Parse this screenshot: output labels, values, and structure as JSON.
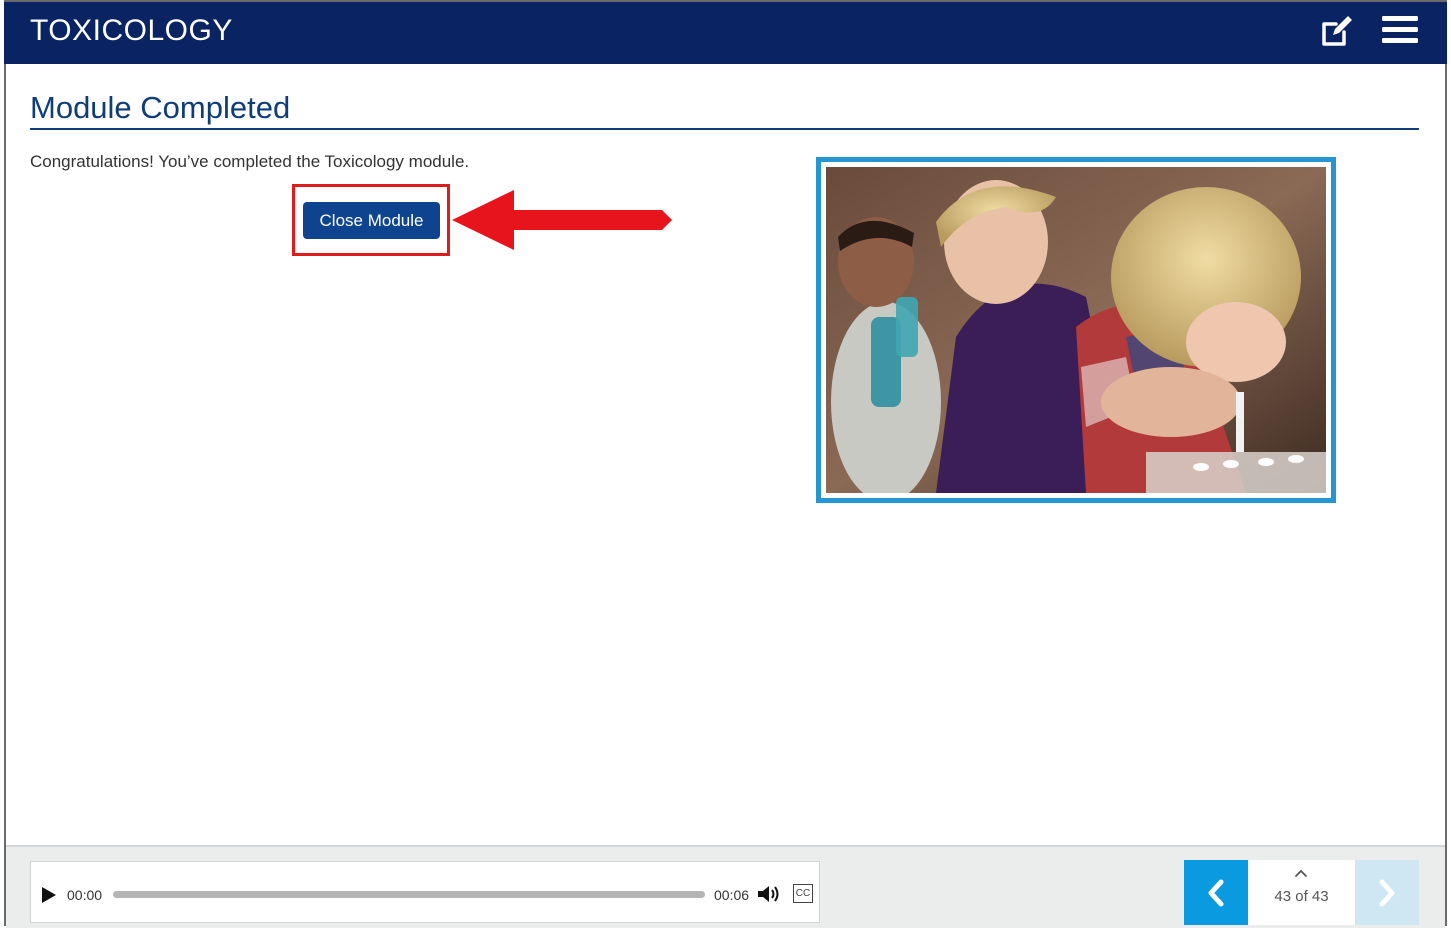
{
  "header": {
    "title": "TOXICOLOGY",
    "background": "#0a2463",
    "icons": [
      "edit-icon",
      "menu-icon"
    ]
  },
  "content": {
    "heading": "Module Completed",
    "message": "Congratulations! You’ve completed the Toxicology module.",
    "close_button_label": "Close Module",
    "accent": "#2596d1",
    "highlight_color": "#e01b1b"
  },
  "player": {
    "current_time": "00:00",
    "duration": "00:06",
    "progress": 0,
    "cc_label": "CC",
    "icons": [
      "play-icon",
      "volume-icon",
      "closed-captions-icon"
    ]
  },
  "navigation": {
    "page_counter": "43 of 43",
    "prev_color": "#0a9ae0",
    "next_color": "#cfe6f3",
    "icons": [
      "chevron-left-icon",
      "chevron-up-icon",
      "chevron-right-icon"
    ]
  }
}
